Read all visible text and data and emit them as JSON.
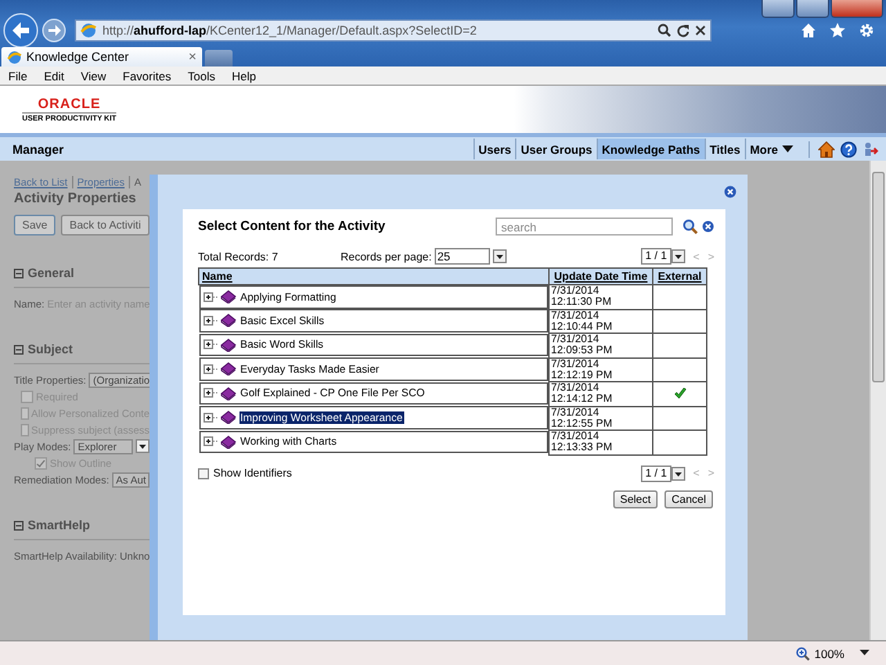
{
  "browser": {
    "address": "http://**ahufford-lap**/KCenter12_1/Manager/Default.aspx?SelectID=2",
    "tab": {
      "title": "Knowledge Center",
      "close": "×"
    },
    "menu": [
      "File",
      "Edit",
      "View",
      "Favorites",
      "Tools",
      "Help"
    ]
  },
  "header": {
    "logo": "ORACLE",
    "product": "USER PRODUCTIVITY KIT"
  },
  "app_bar": {
    "title": "Manager",
    "nav": [
      {
        "label": "Users",
        "selected": false,
        "kind": "link"
      },
      {
        "label": "User Groups",
        "selected": false,
        "kind": "link"
      },
      {
        "label": "Knowledge Paths",
        "selected": true,
        "kind": "link"
      },
      {
        "label": "Titles",
        "selected": false,
        "kind": "link"
      },
      {
        "label": "More",
        "selected": false,
        "kind": "menu"
      }
    ]
  },
  "background_page": {
    "breadcrumbs": [
      "Back to List",
      "Properties",
      "A"
    ],
    "title": "Activity Properties",
    "buttons": [
      "Save",
      "Back to Activiti"
    ],
    "sections": [
      {
        "title": "General",
        "fields": [
          {
            "kind": "text",
            "label": "Name:",
            "placeholder": "Enter an activity name"
          }
        ]
      },
      {
        "title": "Subject",
        "fields": [
          {
            "kind": "cut_field",
            "label": "Title Properties:",
            "value": "(Organizatio"
          },
          {
            "kind": "checkbox",
            "label": "Required",
            "checked": false
          },
          {
            "kind": "checkbox",
            "label": "Allow Personalized Conte",
            "checked": false
          },
          {
            "kind": "checkbox",
            "label": "Suppress subject (assess",
            "checked": false
          },
          {
            "kind": "select",
            "label": "Play Modes:",
            "value": "Explorer",
            "children": [
              {
                "kind": "checkbox",
                "label": "Show Outline",
                "checked": true
              }
            ]
          },
          {
            "kind": "cut_field",
            "label": "Remediation Modes:",
            "value": "As Aut"
          }
        ]
      },
      {
        "title": "SmartHelp",
        "fields": [
          {
            "kind": "info",
            "label": "SmartHelp Availability:",
            "value": "Unkno"
          }
        ]
      }
    ]
  },
  "dialog": {
    "title": "Select Content for the Activity",
    "search": {
      "placeholder": "search"
    },
    "total": "Total Records: 7",
    "per_page": {
      "label": "Records per page:",
      "value": "25"
    },
    "pager": "1 / 1",
    "prev": "<",
    "next": ">",
    "columns": [
      "Name",
      "Update Date Time",
      "External"
    ],
    "rows": [
      {
        "name": "Applying Formatting",
        "date": "7/31/2014",
        "time": "12:11:30 PM",
        "external": false,
        "selected": false
      },
      {
        "name": "Basic Excel Skills",
        "date": "7/31/2014",
        "time": "12:10:44 PM",
        "external": false,
        "selected": false
      },
      {
        "name": "Basic Word Skills",
        "date": "7/31/2014",
        "time": "12:09:53 PM",
        "external": false,
        "selected": false
      },
      {
        "name": "Everyday Tasks Made Easier",
        "date": "7/31/2014",
        "time": "12:12:19 PM",
        "external": false,
        "selected": false
      },
      {
        "name": "Golf Explained - CP One File Per SCO",
        "date": "7/31/2014",
        "time": "12:14:12 PM",
        "external": true,
        "selected": false
      },
      {
        "name": "Improving Worksheet Appearance",
        "date": "7/31/2014",
        "time": "12:12:55 PM",
        "external": false,
        "selected": true
      },
      {
        "name": "Working with Charts",
        "date": "7/31/2014",
        "time": "12:13:33 PM",
        "external": false,
        "selected": false
      }
    ],
    "show_identifiers": {
      "label": "Show Identifiers",
      "checked": false
    },
    "pager_bottom": "1 / 1",
    "prev_bottom": "<",
    "next_bottom": ">",
    "buttons": [
      "Select",
      "Cancel"
    ]
  },
  "status_bar": {
    "zoom": "100%"
  }
}
